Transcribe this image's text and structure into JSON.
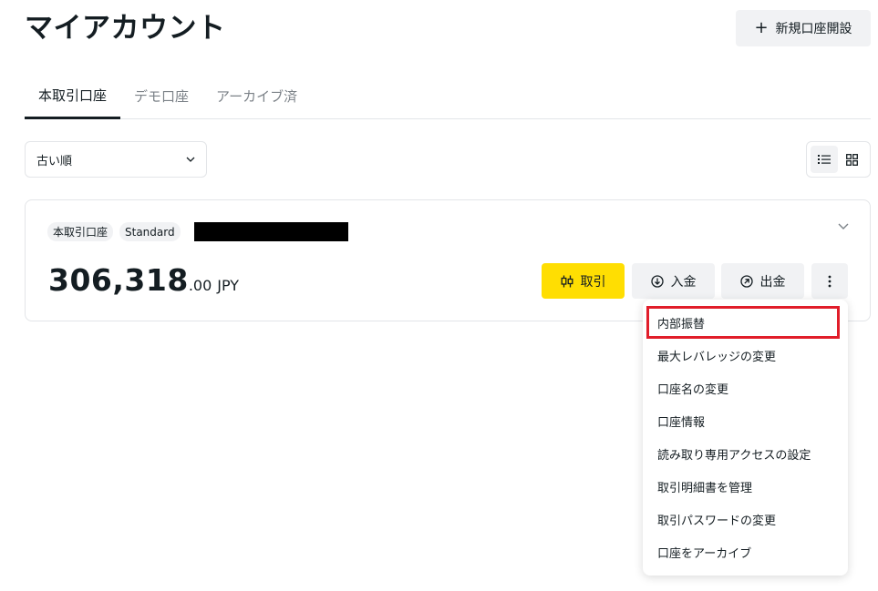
{
  "header": {
    "title": "マイアカウント",
    "new_account_label": "新規口座開設"
  },
  "tabs": [
    {
      "label": "本取引口座",
      "active": true
    },
    {
      "label": "デモ口座",
      "active": false
    },
    {
      "label": "アーカイブ済",
      "active": false
    }
  ],
  "sort": {
    "selected": "古い順"
  },
  "account": {
    "badges": [
      "本取引口座",
      "Standard"
    ],
    "balance_main": "306,318",
    "balance_decimal": ".00",
    "currency": "JPY",
    "actions": {
      "trade": "取引",
      "deposit": "入金",
      "withdraw": "出金"
    }
  },
  "menu": {
    "items": [
      "内部振替",
      "最大レバレッジの変更",
      "口座名の変更",
      "口座情報",
      "読み取り専用アクセスの設定",
      "取引明細書を管理",
      "取引パスワードの変更",
      "口座をアーカイブ"
    ]
  },
  "colors": {
    "accent_yellow": "#ffde02",
    "highlight_red": "#e11d2a",
    "text_dark": "#141d22",
    "button_gray": "#f1f2f4"
  }
}
